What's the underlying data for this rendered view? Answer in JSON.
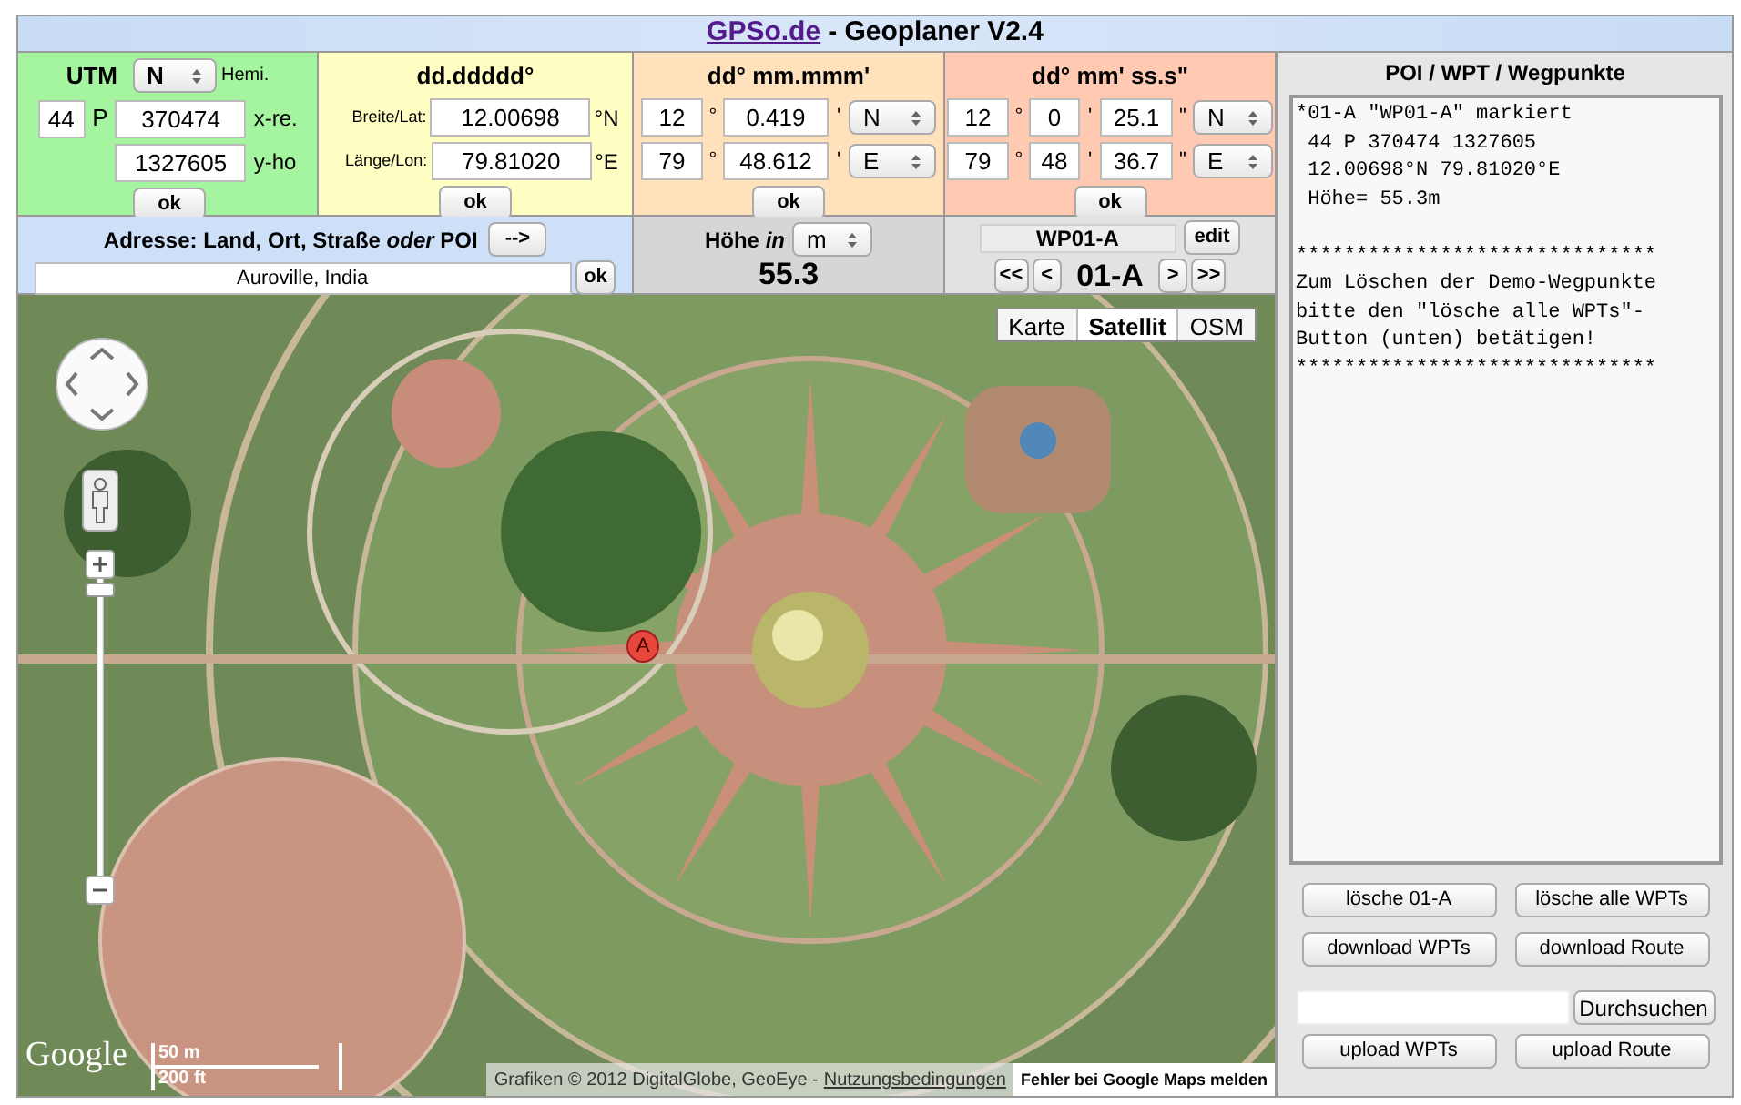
{
  "header": {
    "site_link": "GPSo.de",
    "title": "- Geoplaner V2.4"
  },
  "utm": {
    "heading": "UTM",
    "hemisphere": "N",
    "hemisphere_label": "Hemi.",
    "zone": "44",
    "band": "P",
    "easting": "370474",
    "easting_label": "x-re.",
    "northing": "1327605",
    "northing_label": "y-ho",
    "button": "ok"
  },
  "decimal": {
    "heading": "dd.ddddd°",
    "lat_label": "Breite/Lat:",
    "lat": "12.00698",
    "lat_unit": "°N",
    "lon_label": "Länge/Lon:",
    "lon": "79.81020",
    "lon_unit": "°E",
    "button": "ok"
  },
  "deg_min": {
    "heading": "dd° mm.mmm'",
    "rows": [
      {
        "deg": "12",
        "deg_mark": "°",
        "min": "0.419",
        "min_mark": "'",
        "hemisphere": "N"
      },
      {
        "deg": "79",
        "deg_mark": "°",
        "min": "48.612",
        "min_mark": "'",
        "hemisphere": "E"
      }
    ],
    "button": "ok"
  },
  "deg_min_sec": {
    "heading": "dd° mm' ss.s\"",
    "rows": [
      {
        "deg": "12",
        "deg_mark": "°",
        "min": "0",
        "min_mark": "'",
        "sec": "25.1",
        "sec_mark": "\"",
        "hemisphere": "N"
      },
      {
        "deg": "79",
        "deg_mark": "°",
        "min": "48",
        "min_mark": "'",
        "sec": "36.7",
        "sec_mark": "\"",
        "hemisphere": "E"
      }
    ],
    "button": "ok"
  },
  "address": {
    "label": "Adresse: Land, Ort, Straße *oder* POI",
    "go_button": "-->",
    "value": "Auroville, India",
    "button": "ok"
  },
  "altitude": {
    "label": "Höhe *in*",
    "unit": "m",
    "value": "55.3"
  },
  "waypoint": {
    "name": "WP01-A",
    "edit_button": "edit",
    "current": "01-A",
    "nav_buttons": [
      "<<",
      "<",
      ">",
      ">>"
    ]
  },
  "map": {
    "types": [
      {
        "label": "Karte",
        "selected": false
      },
      {
        "label": "Satellit",
        "selected": true
      },
      {
        "label": "OSM",
        "selected": false
      }
    ],
    "marker": "A",
    "logo": "Google",
    "scale": [
      "50 m",
      "200 ft"
    ],
    "attribution": "Grafiken © 2012 DigitalGlobe, GeoEye -",
    "terms_link": "Nutzungsbedingungen",
    "report_link": "Fehler bei Google Maps melden"
  },
  "waypoints_panel": {
    "heading": "POI / WPT / Wegpunkte",
    "text": "*01-A \"WP01-A\" markiert\n 44 P 370474 1327605\n 12.00698°N 79.81020°E\n Höhe= 55.3m\n\n******************************\nZum Löschen der Demo-Wegpunkte\nbitte den \"lösche alle WPTs\"-\nButton (unten) betätigen!\n******************************",
    "buttons": [
      [
        "lösche 01-A",
        "lösche alle WPTs"
      ],
      [
        "download WPTs",
        "download Route"
      ]
    ],
    "file_button": "Durchsuchen",
    "upload_buttons": [
      "upload WPTs",
      "upload Route"
    ]
  }
}
